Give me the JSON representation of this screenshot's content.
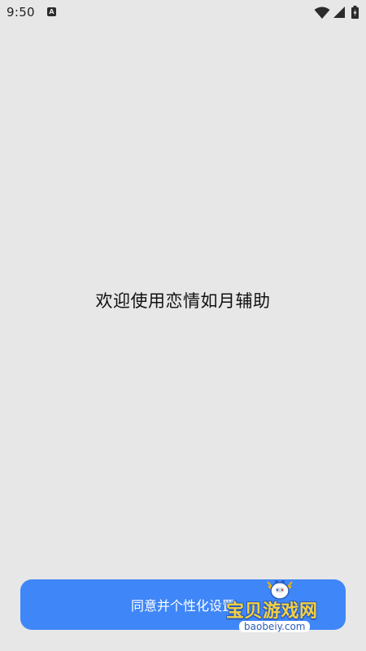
{
  "status_bar": {
    "time": "9:50",
    "notification_badge": "A",
    "icons": [
      "wifi-icon",
      "signal-icon",
      "battery-icon"
    ]
  },
  "main": {
    "welcome_text": "欢迎使用恋情如月辅助"
  },
  "footer": {
    "agree_button_label": "同意并个性化设置"
  },
  "watermark": {
    "site_name": "宝贝游戏网",
    "url": "baobeiy.com"
  },
  "colors": {
    "background": "#e7e7e7",
    "button": "#3f86f8",
    "button_text": "#ffffff",
    "watermark_yellow": "#f4d040",
    "watermark_blue": "#2b5dbd"
  }
}
